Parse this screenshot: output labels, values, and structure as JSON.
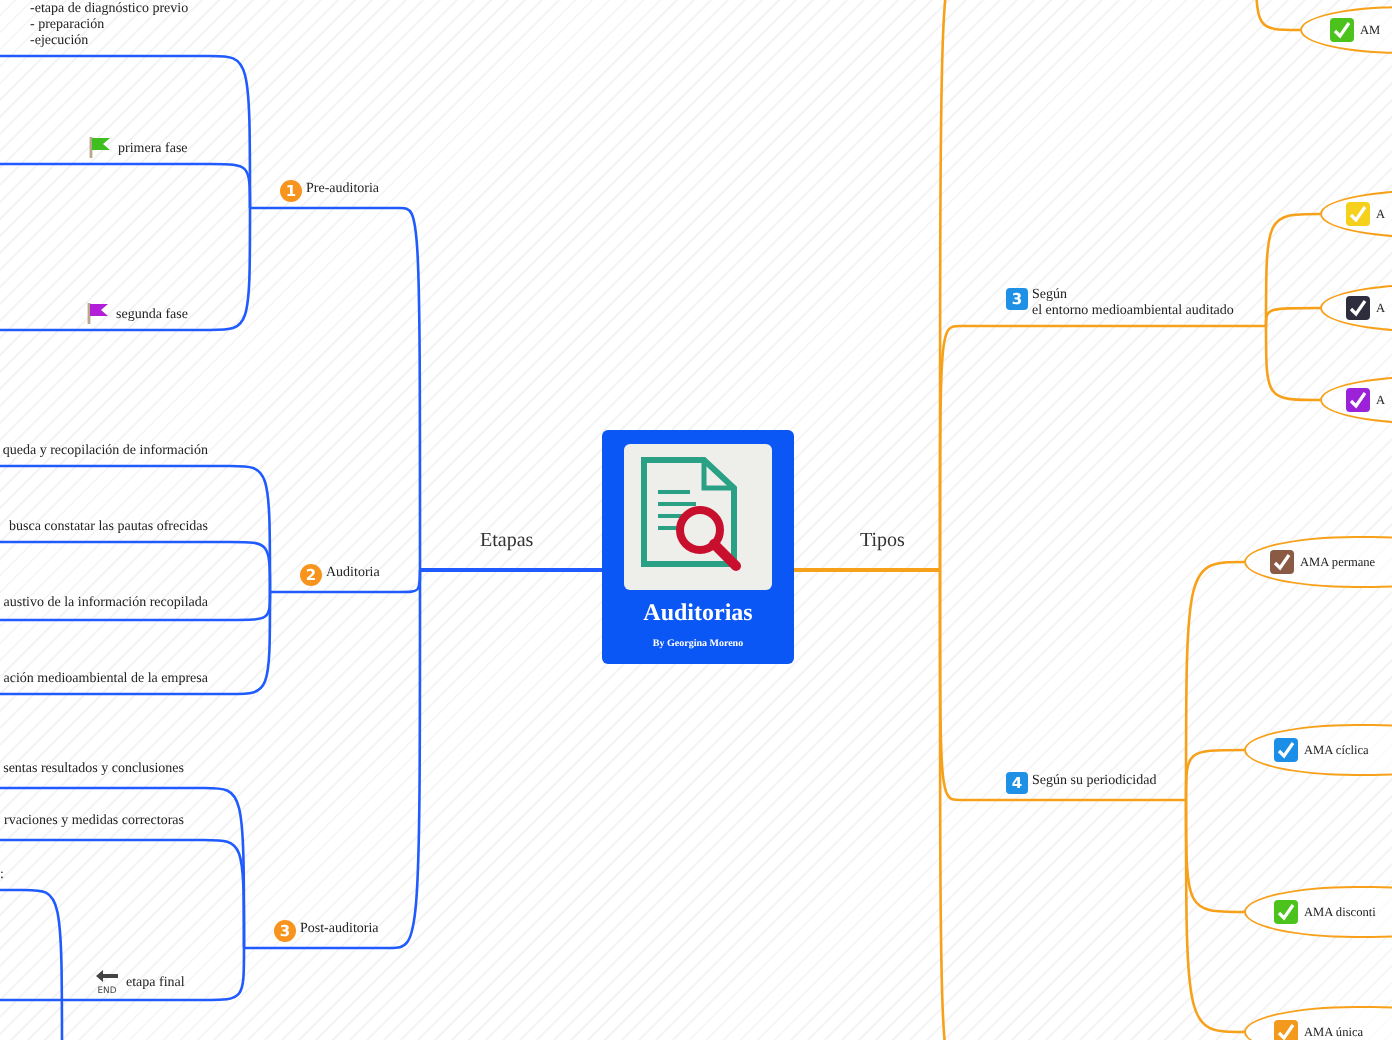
{
  "center": {
    "title": "Auditorias",
    "subtitle": "By Georgina Moreno"
  },
  "branches": [
    {
      "label": "Etapas",
      "color": "#1f5bff",
      "topics": [
        {
          "badge": {
            "text": "1",
            "color": "#f7941d"
          },
          "label": "Pre-auditoria",
          "children": [
            {
              "kind": "text",
              "label": "-etapa de diagnóstico previo\n- preparación\n-ejecución"
            },
            {
              "kind": "flag",
              "label": "primera fase",
              "color": "#3fbf1f"
            },
            {
              "kind": "flag",
              "label": "segunda fase",
              "color": "#b21fd6"
            }
          ]
        },
        {
          "badge": {
            "text": "2",
            "color": "#f7941d"
          },
          "label": "Auditoria",
          "children": [
            {
              "kind": "text",
              "label": "queda y recopilación de información"
            },
            {
              "kind": "text",
              "label": "busca constatar las pautas ofrecidas"
            },
            {
              "kind": "text",
              "label": "austivo de la información recopilada"
            },
            {
              "kind": "text",
              "label": "ación medioambiental de la empresa"
            }
          ]
        },
        {
          "badge": {
            "text": "3",
            "color": "#f7941d"
          },
          "label": "Post-auditoria",
          "children": [
            {
              "kind": "text",
              "label": "sentas resultados y conclusiones"
            },
            {
              "kind": "text",
              "label": "rvaciones y medidas correctoras"
            },
            {
              "kind": "text",
              "label": ":"
            },
            {
              "kind": "end",
              "label": "etapa final",
              "icon_text": "END"
            }
          ]
        }
      ]
    },
    {
      "label": "Tipos",
      "color": "#f7a11a",
      "topics": [
        {
          "children": [
            {
              "kind": "check",
              "label": "AM",
              "color": "#4cc21c"
            }
          ]
        },
        {
          "badge": {
            "text": "3",
            "color": "#1e90e6"
          },
          "label": "Según\nel entorno medioambiental auditado",
          "children": [
            {
              "kind": "check",
              "label": "A",
              "color": "#f5d01c"
            },
            {
              "kind": "check",
              "label": "A",
              "color": "#2e2d3d"
            },
            {
              "kind": "check",
              "label": "A",
              "color": "#9b22d9"
            }
          ]
        },
        {
          "badge": {
            "text": "4",
            "color": "#1e90e6"
          },
          "label": "Según su periodicidad",
          "children": [
            {
              "kind": "check",
              "label": "AMA permane",
              "color": "#8a5a44"
            },
            {
              "kind": "check",
              "label": "AMA cíclica",
              "color": "#1b8fe8"
            },
            {
              "kind": "check",
              "label": "AMA disconti",
              "color": "#4cc21c"
            },
            {
              "kind": "check",
              "label": "AMA única",
              "color": "#f39a1d"
            }
          ]
        }
      ]
    }
  ]
}
